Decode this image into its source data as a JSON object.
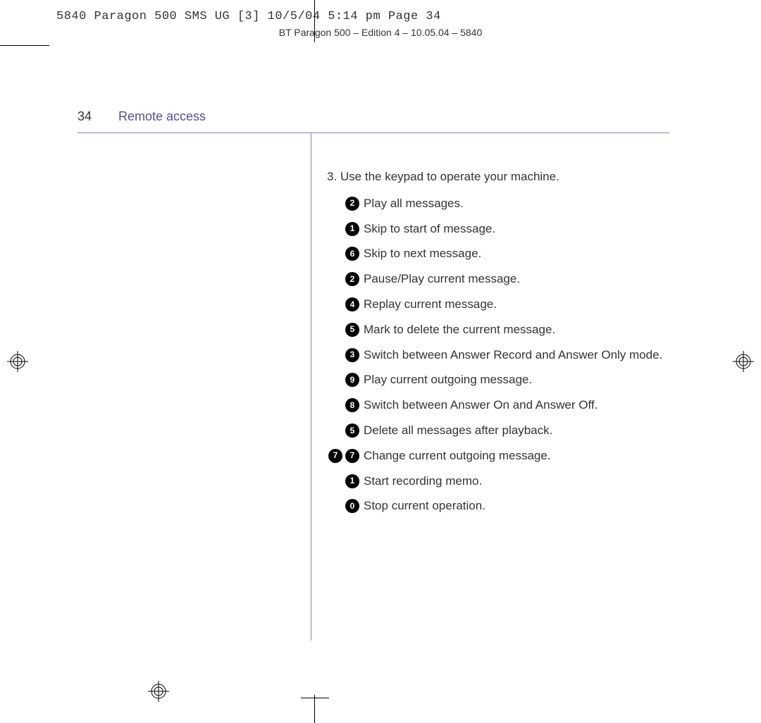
{
  "print": {
    "header": "5840 Paragon 500 SMS UG [3]  10/5/04  5:14 pm  Page 34",
    "subheader": "BT Paragon 500 – Edition 4 – 10.05.04 – 5840"
  },
  "page": {
    "number": "34",
    "section": "Remote access",
    "intro": "3. Use the keypad to operate your machine.",
    "items": [
      {
        "keys": [
          "2"
        ],
        "text": "Play all messages."
      },
      {
        "keys": [
          "1"
        ],
        "text": "Skip to start of message."
      },
      {
        "keys": [
          "6"
        ],
        "text": "Skip to next message."
      },
      {
        "keys": [
          "2"
        ],
        "text": "Pause/Play current message."
      },
      {
        "keys": [
          "4"
        ],
        "text": "Replay current message."
      },
      {
        "keys": [
          "5"
        ],
        "text": "Mark to delete the current message."
      },
      {
        "keys": [
          "3"
        ],
        "text": "Switch between Answer Record and Answer Only mode."
      },
      {
        "keys": [
          "9"
        ],
        "text": "Play current outgoing message."
      },
      {
        "keys": [
          "8"
        ],
        "text": "Switch between Answer On and Answer Off."
      },
      {
        "keys": [
          "5"
        ],
        "text": "Delete all messages after playback."
      },
      {
        "keys": [
          "7",
          "7"
        ],
        "text": "Change current outgoing message."
      },
      {
        "keys": [
          "1"
        ],
        "text": "Start recording memo."
      },
      {
        "keys": [
          "0"
        ],
        "text": "Stop current operation."
      }
    ]
  }
}
